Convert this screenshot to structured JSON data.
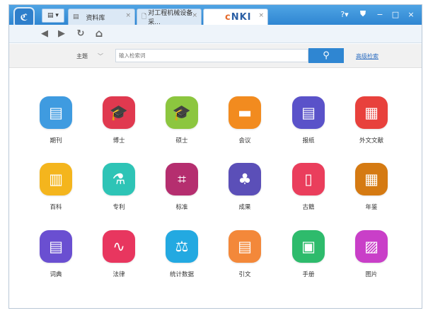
{
  "titlebar": {
    "app_logo": "cnki-app-icon",
    "tab_menu_glyph": "▤ ▾",
    "tabs": [
      {
        "icon": "▤",
        "label": "资料库"
      },
      {
        "icon": "🗋",
        "label": "对工程机械设备采..."
      },
      {
        "icon": "",
        "label": ""
      }
    ],
    "tab_close": "×",
    "active_tab_brand": "cnki",
    "window_controls": [
      "?▾",
      "⛊",
      "−",
      "□",
      "×"
    ],
    "accent_color": "#2f86d2"
  },
  "toolbar": {
    "back": "◀",
    "forward": "▶",
    "refresh": "↻",
    "home": "⌂"
  },
  "search": {
    "scope_label": "主题",
    "scope_arrow": "﹀",
    "placeholder": "输入检索词",
    "button_glyph": "⚲",
    "advanced_link": "高级检索"
  },
  "categories": [
    {
      "label": "期刊",
      "color": "#3f9be0",
      "glyph": "▤"
    },
    {
      "label": "博士",
      "color": "#e0394f",
      "glyph": "🎓"
    },
    {
      "label": "硕士",
      "color": "#8cc63f",
      "glyph": "🎓"
    },
    {
      "label": "会议",
      "color": "#f28b1f",
      "glyph": "▬"
    },
    {
      "label": "报纸",
      "color": "#5a52c9",
      "glyph": "▤"
    },
    {
      "label": "外文文献",
      "color": "#e8413c",
      "glyph": "▦"
    },
    {
      "label": "百科",
      "color": "#f4b51d",
      "glyph": "▥"
    },
    {
      "label": "专利",
      "color": "#2ec4b6",
      "glyph": "⚗"
    },
    {
      "label": "标准",
      "color": "#b52e6f",
      "glyph": "⌗"
    },
    {
      "label": "成果",
      "color": "#5b4fb8",
      "glyph": "♣"
    },
    {
      "label": "古籍",
      "color": "#ea3e5c",
      "glyph": "▯"
    },
    {
      "label": "年鉴",
      "color": "#d57a12",
      "glyph": "▦"
    },
    {
      "label": "词典",
      "color": "#6a4fd1",
      "glyph": "▤"
    },
    {
      "label": "法律",
      "color": "#e8365f",
      "glyph": "∿"
    },
    {
      "label": "统计数据",
      "color": "#23a9e1",
      "glyph": "⚖"
    },
    {
      "label": "引文",
      "color": "#f3883a",
      "glyph": "▤"
    },
    {
      "label": "手册",
      "color": "#2ebb6c",
      "glyph": "▣"
    },
    {
      "label": "图片",
      "color": "#c93fc8",
      "glyph": "▨"
    }
  ]
}
